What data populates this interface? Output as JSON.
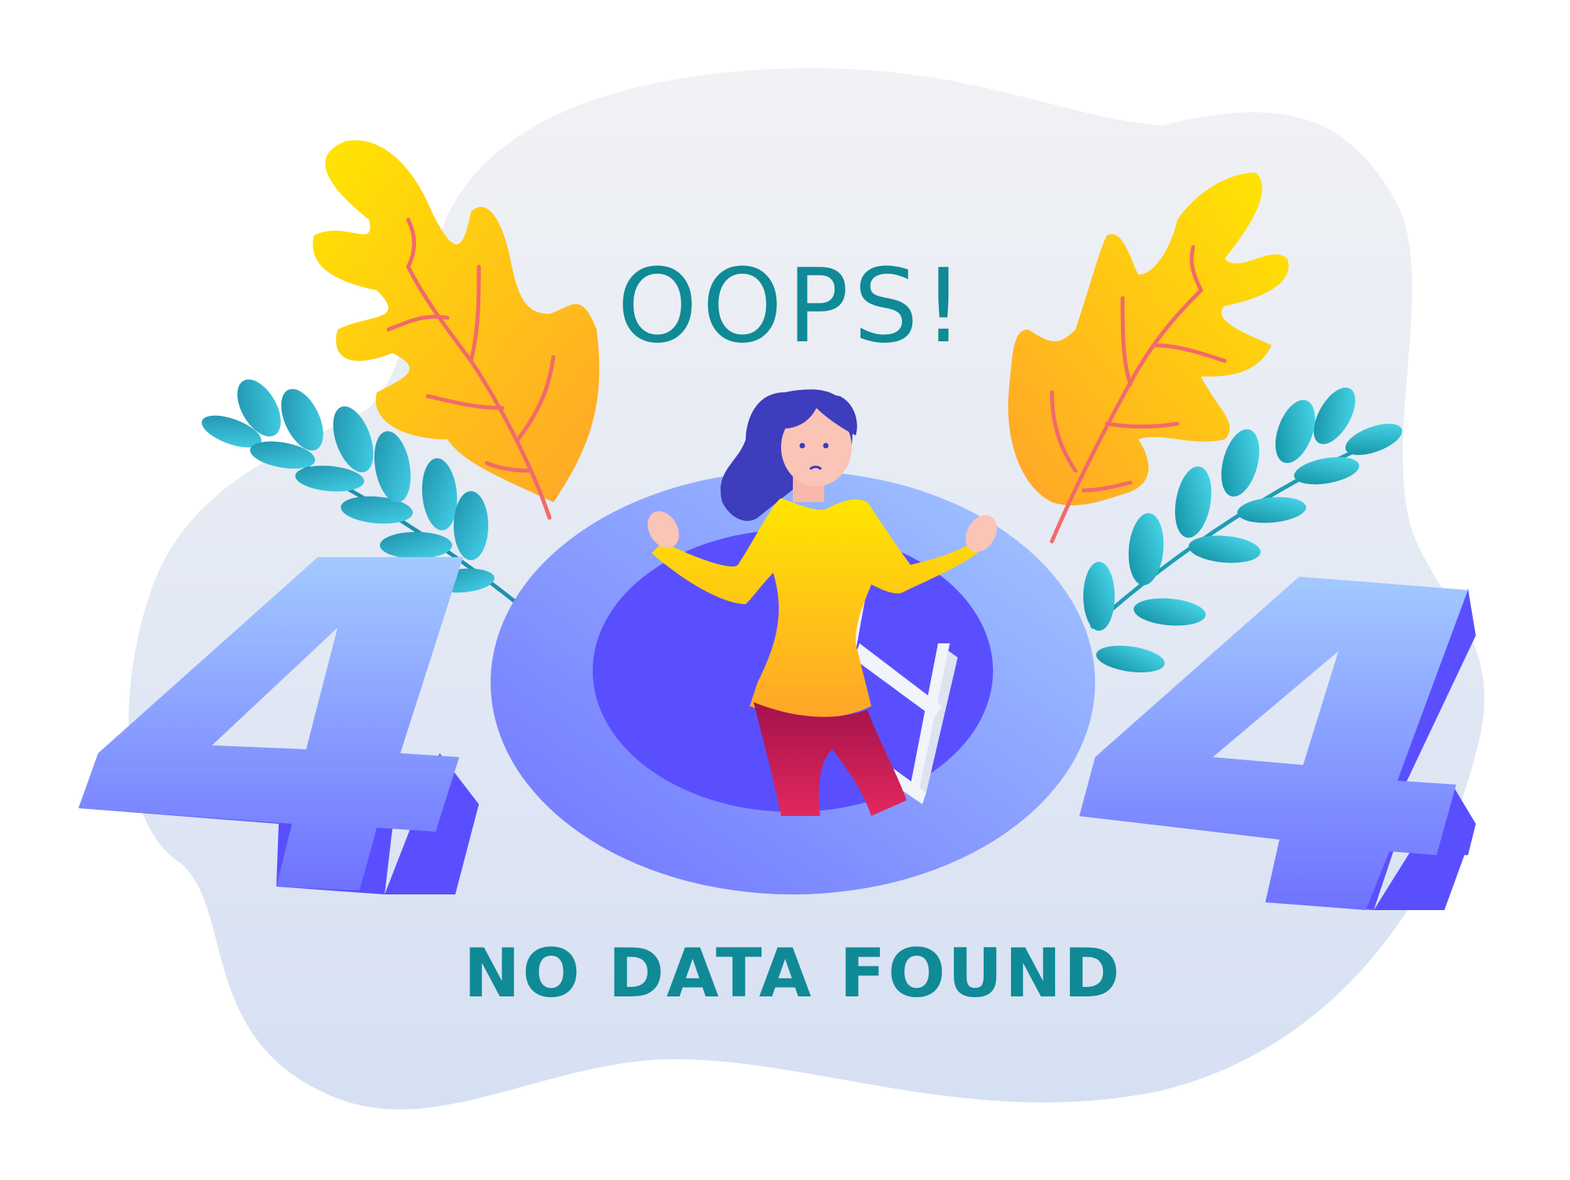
{
  "heading": "OOPS!",
  "code": {
    "d1": "4",
    "d3": "4"
  },
  "message": "NO DATA FOUND",
  "colors": {
    "text": "#0F8A96",
    "digit_top": "#A6C8FF",
    "digit_side": "#5A4FFF",
    "hole_rim": "#9DB8FF",
    "hole_inner": "#5A4FFF",
    "leaf_yellow": "#FFE300",
    "leaf_orange": "#FFA62B",
    "leaf_vein": "#F36B6B",
    "fern_teal": "#1B9EB6",
    "fern_cyan": "#4BD6EA",
    "blob": "#E8ECF6"
  }
}
